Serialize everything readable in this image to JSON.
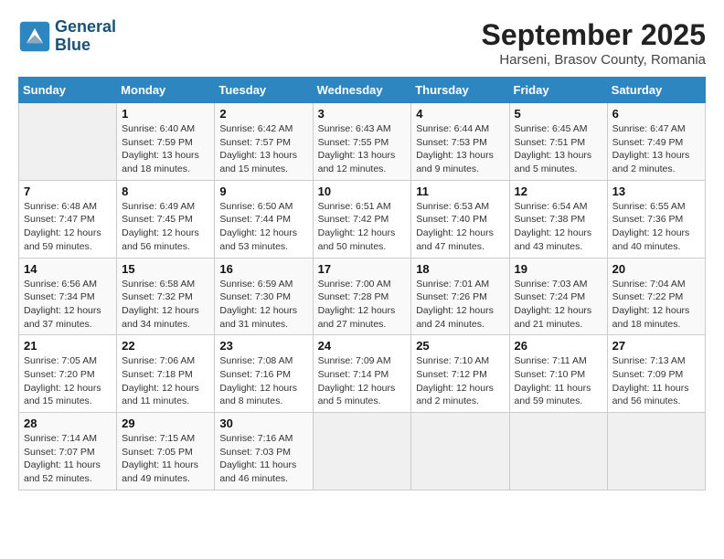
{
  "header": {
    "logo_line1": "General",
    "logo_line2": "Blue",
    "month_title": "September 2025",
    "subtitle": "Harseni, Brasov County, Romania"
  },
  "weekdays": [
    "Sunday",
    "Monday",
    "Tuesday",
    "Wednesday",
    "Thursday",
    "Friday",
    "Saturday"
  ],
  "weeks": [
    [
      {
        "day": "",
        "info": ""
      },
      {
        "day": "1",
        "info": "Sunrise: 6:40 AM\nSunset: 7:59 PM\nDaylight: 13 hours\nand 18 minutes."
      },
      {
        "day": "2",
        "info": "Sunrise: 6:42 AM\nSunset: 7:57 PM\nDaylight: 13 hours\nand 15 minutes."
      },
      {
        "day": "3",
        "info": "Sunrise: 6:43 AM\nSunset: 7:55 PM\nDaylight: 13 hours\nand 12 minutes."
      },
      {
        "day": "4",
        "info": "Sunrise: 6:44 AM\nSunset: 7:53 PM\nDaylight: 13 hours\nand 9 minutes."
      },
      {
        "day": "5",
        "info": "Sunrise: 6:45 AM\nSunset: 7:51 PM\nDaylight: 13 hours\nand 5 minutes."
      },
      {
        "day": "6",
        "info": "Sunrise: 6:47 AM\nSunset: 7:49 PM\nDaylight: 13 hours\nand 2 minutes."
      }
    ],
    [
      {
        "day": "7",
        "info": "Sunrise: 6:48 AM\nSunset: 7:47 PM\nDaylight: 12 hours\nand 59 minutes."
      },
      {
        "day": "8",
        "info": "Sunrise: 6:49 AM\nSunset: 7:45 PM\nDaylight: 12 hours\nand 56 minutes."
      },
      {
        "day": "9",
        "info": "Sunrise: 6:50 AM\nSunset: 7:44 PM\nDaylight: 12 hours\nand 53 minutes."
      },
      {
        "day": "10",
        "info": "Sunrise: 6:51 AM\nSunset: 7:42 PM\nDaylight: 12 hours\nand 50 minutes."
      },
      {
        "day": "11",
        "info": "Sunrise: 6:53 AM\nSunset: 7:40 PM\nDaylight: 12 hours\nand 47 minutes."
      },
      {
        "day": "12",
        "info": "Sunrise: 6:54 AM\nSunset: 7:38 PM\nDaylight: 12 hours\nand 43 minutes."
      },
      {
        "day": "13",
        "info": "Sunrise: 6:55 AM\nSunset: 7:36 PM\nDaylight: 12 hours\nand 40 minutes."
      }
    ],
    [
      {
        "day": "14",
        "info": "Sunrise: 6:56 AM\nSunset: 7:34 PM\nDaylight: 12 hours\nand 37 minutes."
      },
      {
        "day": "15",
        "info": "Sunrise: 6:58 AM\nSunset: 7:32 PM\nDaylight: 12 hours\nand 34 minutes."
      },
      {
        "day": "16",
        "info": "Sunrise: 6:59 AM\nSunset: 7:30 PM\nDaylight: 12 hours\nand 31 minutes."
      },
      {
        "day": "17",
        "info": "Sunrise: 7:00 AM\nSunset: 7:28 PM\nDaylight: 12 hours\nand 27 minutes."
      },
      {
        "day": "18",
        "info": "Sunrise: 7:01 AM\nSunset: 7:26 PM\nDaylight: 12 hours\nand 24 minutes."
      },
      {
        "day": "19",
        "info": "Sunrise: 7:03 AM\nSunset: 7:24 PM\nDaylight: 12 hours\nand 21 minutes."
      },
      {
        "day": "20",
        "info": "Sunrise: 7:04 AM\nSunset: 7:22 PM\nDaylight: 12 hours\nand 18 minutes."
      }
    ],
    [
      {
        "day": "21",
        "info": "Sunrise: 7:05 AM\nSunset: 7:20 PM\nDaylight: 12 hours\nand 15 minutes."
      },
      {
        "day": "22",
        "info": "Sunrise: 7:06 AM\nSunset: 7:18 PM\nDaylight: 12 hours\nand 11 minutes."
      },
      {
        "day": "23",
        "info": "Sunrise: 7:08 AM\nSunset: 7:16 PM\nDaylight: 12 hours\nand 8 minutes."
      },
      {
        "day": "24",
        "info": "Sunrise: 7:09 AM\nSunset: 7:14 PM\nDaylight: 12 hours\nand 5 minutes."
      },
      {
        "day": "25",
        "info": "Sunrise: 7:10 AM\nSunset: 7:12 PM\nDaylight: 12 hours\nand 2 minutes."
      },
      {
        "day": "26",
        "info": "Sunrise: 7:11 AM\nSunset: 7:10 PM\nDaylight: 11 hours\nand 59 minutes."
      },
      {
        "day": "27",
        "info": "Sunrise: 7:13 AM\nSunset: 7:09 PM\nDaylight: 11 hours\nand 56 minutes."
      }
    ],
    [
      {
        "day": "28",
        "info": "Sunrise: 7:14 AM\nSunset: 7:07 PM\nDaylight: 11 hours\nand 52 minutes."
      },
      {
        "day": "29",
        "info": "Sunrise: 7:15 AM\nSunset: 7:05 PM\nDaylight: 11 hours\nand 49 minutes."
      },
      {
        "day": "30",
        "info": "Sunrise: 7:16 AM\nSunset: 7:03 PM\nDaylight: 11 hours\nand 46 minutes."
      },
      {
        "day": "",
        "info": ""
      },
      {
        "day": "",
        "info": ""
      },
      {
        "day": "",
        "info": ""
      },
      {
        "day": "",
        "info": ""
      }
    ]
  ]
}
